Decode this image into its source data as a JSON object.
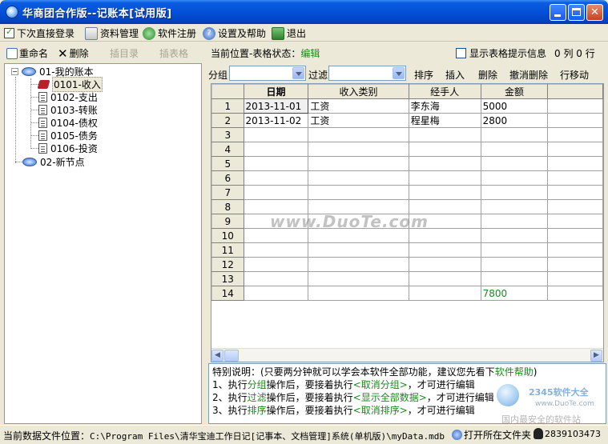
{
  "window": {
    "title": "华商团合作版--记账本[试用版]"
  },
  "menu": {
    "autologin": "下次直接登录",
    "autologin_checked": true,
    "items": [
      "资料管理",
      "软件注册",
      "设置及帮助",
      "退出"
    ]
  },
  "left_toolbar": {
    "rename": "重命名",
    "delete": "删除",
    "insert_dir": "插目录",
    "insert_table": "插表格"
  },
  "tree": [
    {
      "label": "01-我的账本",
      "level": 0,
      "expanded": true,
      "children": [
        {
          "label": "0101-收入",
          "selected": true
        },
        {
          "label": "0102-支出"
        },
        {
          "label": "0103-转账"
        },
        {
          "label": "0104-债权"
        },
        {
          "label": "0105-债务"
        },
        {
          "label": "0106-投资"
        }
      ]
    },
    {
      "label": "02-新节点",
      "level": 0
    }
  ],
  "status": {
    "prefix": "当前位置-表格状态：",
    "state": "编辑",
    "show_tips": "显示表格提示信息",
    "show_tips_checked": false,
    "counts": "0 列 0 行"
  },
  "filter_bar": {
    "group_label": "分组",
    "filter_label": "过滤",
    "buttons": [
      "排序",
      "插入",
      "删除",
      "撤消删除",
      "行移动"
    ]
  },
  "grid": {
    "columns": [
      "日期",
      "收入类别",
      "经手人",
      "金额"
    ],
    "rows": [
      {
        "n": "1",
        "cells": [
          "2013-11-01",
          "工资",
          "李东海",
          "5000"
        ]
      },
      {
        "n": "2",
        "cells": [
          "2013-11-02",
          "工资",
          "程星梅",
          "2800"
        ]
      },
      {
        "n": "3",
        "cells": [
          "",
          "",
          "",
          ""
        ]
      },
      {
        "n": "4",
        "cells": [
          "",
          "",
          "",
          ""
        ]
      },
      {
        "n": "5",
        "cells": [
          "",
          "",
          "",
          ""
        ]
      },
      {
        "n": "6",
        "cells": [
          "",
          "",
          "",
          ""
        ]
      },
      {
        "n": "7",
        "cells": [
          "",
          "",
          "",
          ""
        ]
      },
      {
        "n": "8",
        "cells": [
          "",
          "",
          "",
          ""
        ]
      },
      {
        "n": "9",
        "cells": [
          "",
          "",
          "",
          ""
        ]
      },
      {
        "n": "10",
        "cells": [
          "",
          "",
          "",
          ""
        ]
      },
      {
        "n": "11",
        "cells": [
          "",
          "",
          "",
          ""
        ]
      },
      {
        "n": "12",
        "cells": [
          "",
          "",
          "",
          ""
        ]
      },
      {
        "n": "13",
        "cells": [
          "",
          "",
          "",
          ""
        ]
      },
      {
        "n": "14",
        "cells": [
          "",
          "",
          "",
          "7800"
        ]
      }
    ]
  },
  "notes": {
    "line1_a": "特别说明：(只要两分钟就可以学会本软件全部功能，建议您先看下",
    "line1_g": "软件帮助",
    "line1_b": ")",
    "line2_a": "1、执行",
    "line2_g1": "分组",
    "line2_b": "操作后，要接着执行",
    "line2_g2": "<取消分组>",
    "line2_c": "，才可进行编辑",
    "line3_a": "2、执行",
    "line3_g1": "过滤",
    "line3_b": "操作后，要接着执行",
    "line3_g2": "<显示全部数据>",
    "line3_c": "，才可进行编辑",
    "line4_a": "3、执行",
    "line4_g1": "排序",
    "line4_b": "操作后，要接着执行",
    "line4_g2": "<取消排序>",
    "line4_c": "，才可进行编辑"
  },
  "statusbar": {
    "path_label": "当前数据文件位置：",
    "path": "C:\\Program Files\\清华宝迪工作日记[记事本、文档管理]系统(单机版)\\myData.mdb",
    "open_folder": "打开所在文件夹",
    "qq": "2839103473"
  },
  "watermark": "www.DuoTe.com",
  "corner_watermark": {
    "brand": "2345软件大全",
    "url": "www.DuoTe.com",
    "slogan": "国内最安全的软件站"
  },
  "colors": {
    "titlebar": "#0450d8",
    "accent_green": "#1b8a1b",
    "window_bg": "#ece9d8"
  }
}
